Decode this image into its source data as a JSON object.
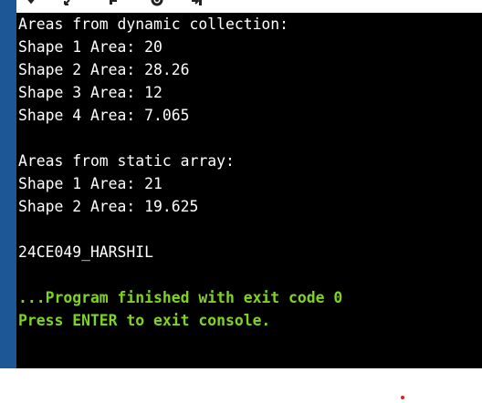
{
  "toolbar": {
    "icons": [
      "chevron-down-icon",
      "fullscreen-icon",
      "settings-icon",
      "gear-icon",
      "exit-icon"
    ]
  },
  "console": {
    "lines": [
      "Areas from dynamic collection:",
      "Shape 1 Area: 20",
      "Shape 2 Area: 28.26",
      "Shape 3 Area: 12",
      "Shape 4 Area: 7.065",
      "",
      "Areas from static array:",
      "Shape 1 Area: 21",
      "Shape 2 Area: 19.625",
      "",
      "24CE049_HARSHIL",
      "",
      "...Program finished with exit code 0",
      "Press ENTER to exit console."
    ]
  },
  "colors": {
    "console_background": "#000000",
    "console_text": "#ffffff",
    "status_text": "#7fd321",
    "left_strip": "#1e5796",
    "marker_dot": "#e0211f"
  }
}
